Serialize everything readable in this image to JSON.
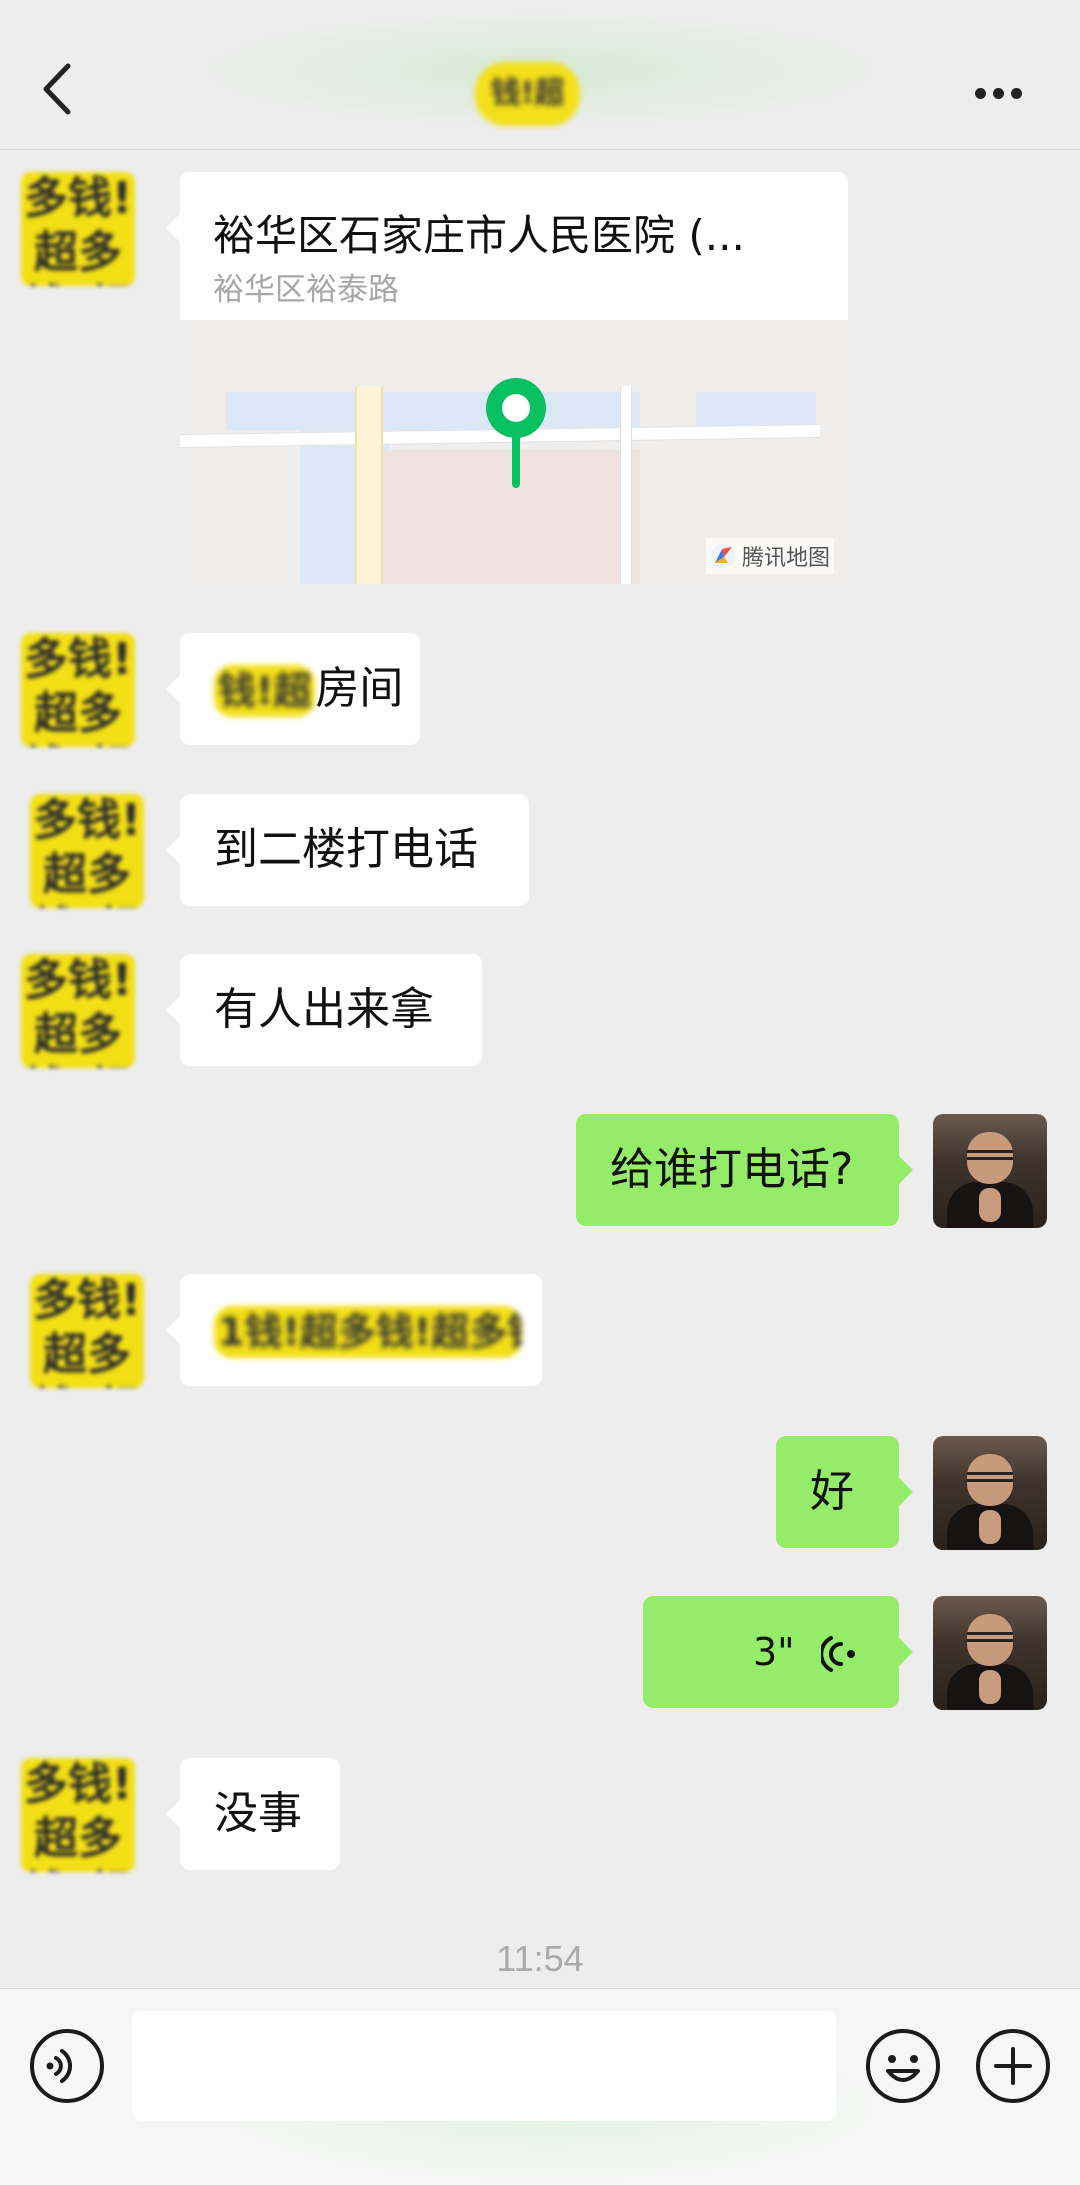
{
  "header": {
    "title_redacted": "钱!超"
  },
  "avatars": {
    "contact": "多钱!超多钱!超多钱!超"
  },
  "messages": [
    {
      "type": "location",
      "side": "left",
      "title": "裕华区石家庄市人民医院 (...",
      "subtitle": "裕华区裕泰路",
      "map_brand": "腾讯地图"
    },
    {
      "type": "text",
      "side": "left",
      "redacted": "钱!超",
      "text": "房间"
    },
    {
      "type": "text",
      "side": "left",
      "text": "到二楼打电话"
    },
    {
      "type": "text",
      "side": "left",
      "text": "有人出来拿"
    },
    {
      "type": "text",
      "side": "right",
      "text": "给谁打电话?"
    },
    {
      "type": "text",
      "side": "left",
      "redacted": "1钱!超多钱!超多钱"
    },
    {
      "type": "text",
      "side": "right",
      "text": "好"
    },
    {
      "type": "voice",
      "side": "right",
      "duration": "3\""
    },
    {
      "type": "text",
      "side": "left",
      "text": "没事"
    }
  ],
  "timestamp": "11:54",
  "input": {
    "placeholder": ""
  },
  "colors": {
    "background": "#ededed",
    "sent_bubble": "#95ec69",
    "received_bubble": "#ffffff",
    "pin": "#07c160"
  }
}
